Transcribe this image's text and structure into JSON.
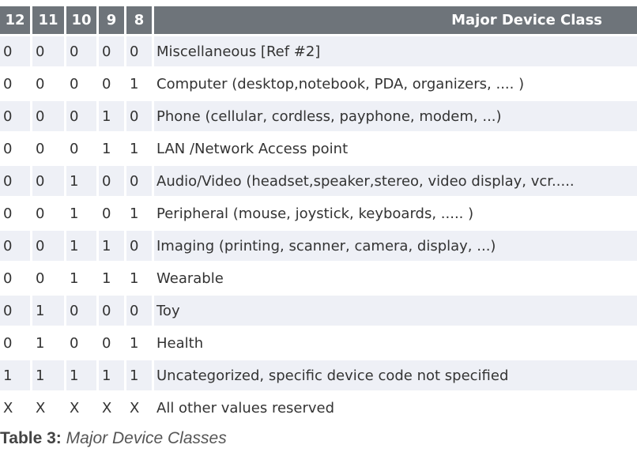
{
  "table": {
    "headers": [
      "12",
      "11",
      "10",
      "9",
      "8",
      "Major Device Class"
    ],
    "rows": [
      {
        "bits": [
          "0",
          "0",
          "0",
          "0",
          "0"
        ],
        "desc": "Miscellaneous [Ref #2]"
      },
      {
        "bits": [
          "0",
          "0",
          "0",
          "0",
          "1"
        ],
        "desc": "Computer (desktop,notebook, PDA, organizers, .... )"
      },
      {
        "bits": [
          "0",
          "0",
          "0",
          "1",
          "0"
        ],
        "desc": "Phone (cellular, cordless, payphone, modem, ...)"
      },
      {
        "bits": [
          "0",
          "0",
          "0",
          "1",
          "1"
        ],
        "desc": "LAN /Network Access point"
      },
      {
        "bits": [
          "0",
          "0",
          "1",
          "0",
          "0"
        ],
        "desc": "Audio/Video (headset,speaker,stereo, video display, vcr....."
      },
      {
        "bits": [
          "0",
          "0",
          "1",
          "0",
          "1"
        ],
        "desc": "Peripheral (mouse, joystick, keyboards, ..... )"
      },
      {
        "bits": [
          "0",
          "0",
          "1",
          "1",
          "0"
        ],
        "desc": "Imaging (printing, scanner, camera, display, ...)"
      },
      {
        "bits": [
          "0",
          "0",
          "1",
          "1",
          "1"
        ],
        "desc": "Wearable"
      },
      {
        "bits": [
          "0",
          "1",
          "0",
          "0",
          "0"
        ],
        "desc": "Toy"
      },
      {
        "bits": [
          "0",
          "1",
          "0",
          "0",
          "1"
        ],
        "desc": "Health"
      },
      {
        "bits": [
          "1",
          "1",
          "1",
          "1",
          "1"
        ],
        "desc": "Uncategorized, specific device code not specified"
      },
      {
        "bits": [
          "X",
          "X",
          "X",
          "X",
          "X"
        ],
        "desc": "All other values reserved"
      }
    ]
  },
  "caption": {
    "label": "Table 3:",
    "text": "Major Device Classes"
  },
  "colors": {
    "header_bg": "#6e747a",
    "header_text": "#ffffff",
    "row_shaded": "#eef0f6",
    "row_plain": "#ffffff"
  }
}
